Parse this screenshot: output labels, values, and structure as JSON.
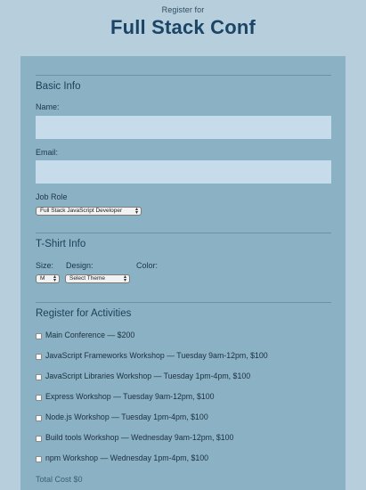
{
  "header": {
    "kicker": "Register for",
    "title": "Full Stack Conf"
  },
  "basic_info": {
    "title": "Basic Info",
    "name_label": "Name:",
    "name_value": "",
    "email_label": "Email:",
    "email_value": "",
    "job_role_label": "Job Role",
    "job_role_selected": "Full Stack JavaScript Developer"
  },
  "tshirt": {
    "title": "T-Shirt Info",
    "size_label": "Size:",
    "size_selected": "M",
    "design_label": "Design:",
    "design_selected": "Select Theme",
    "color_label": "Color:"
  },
  "activities": {
    "title": "Register for Activities",
    "items": [
      {
        "label": "Main Conference — $200",
        "checked": false
      },
      {
        "label": "JavaScript Frameworks Workshop — Tuesday 9am-12pm, $100",
        "checked": false
      },
      {
        "label": "JavaScript Libraries Workshop — Tuesday 1pm-4pm, $100",
        "checked": false
      },
      {
        "label": "Express Workshop — Tuesday 9am-12pm, $100",
        "checked": false
      },
      {
        "label": "Node.js Workshop — Tuesday 1pm-4pm, $100",
        "checked": false
      },
      {
        "label": "Build tools Workshop — Wednesday 9am-12pm, $100",
        "checked": false
      },
      {
        "label": "npm Workshop — Wednesday 1pm-4pm, $100",
        "checked": false
      }
    ],
    "total_label": "Total Cost $0"
  }
}
